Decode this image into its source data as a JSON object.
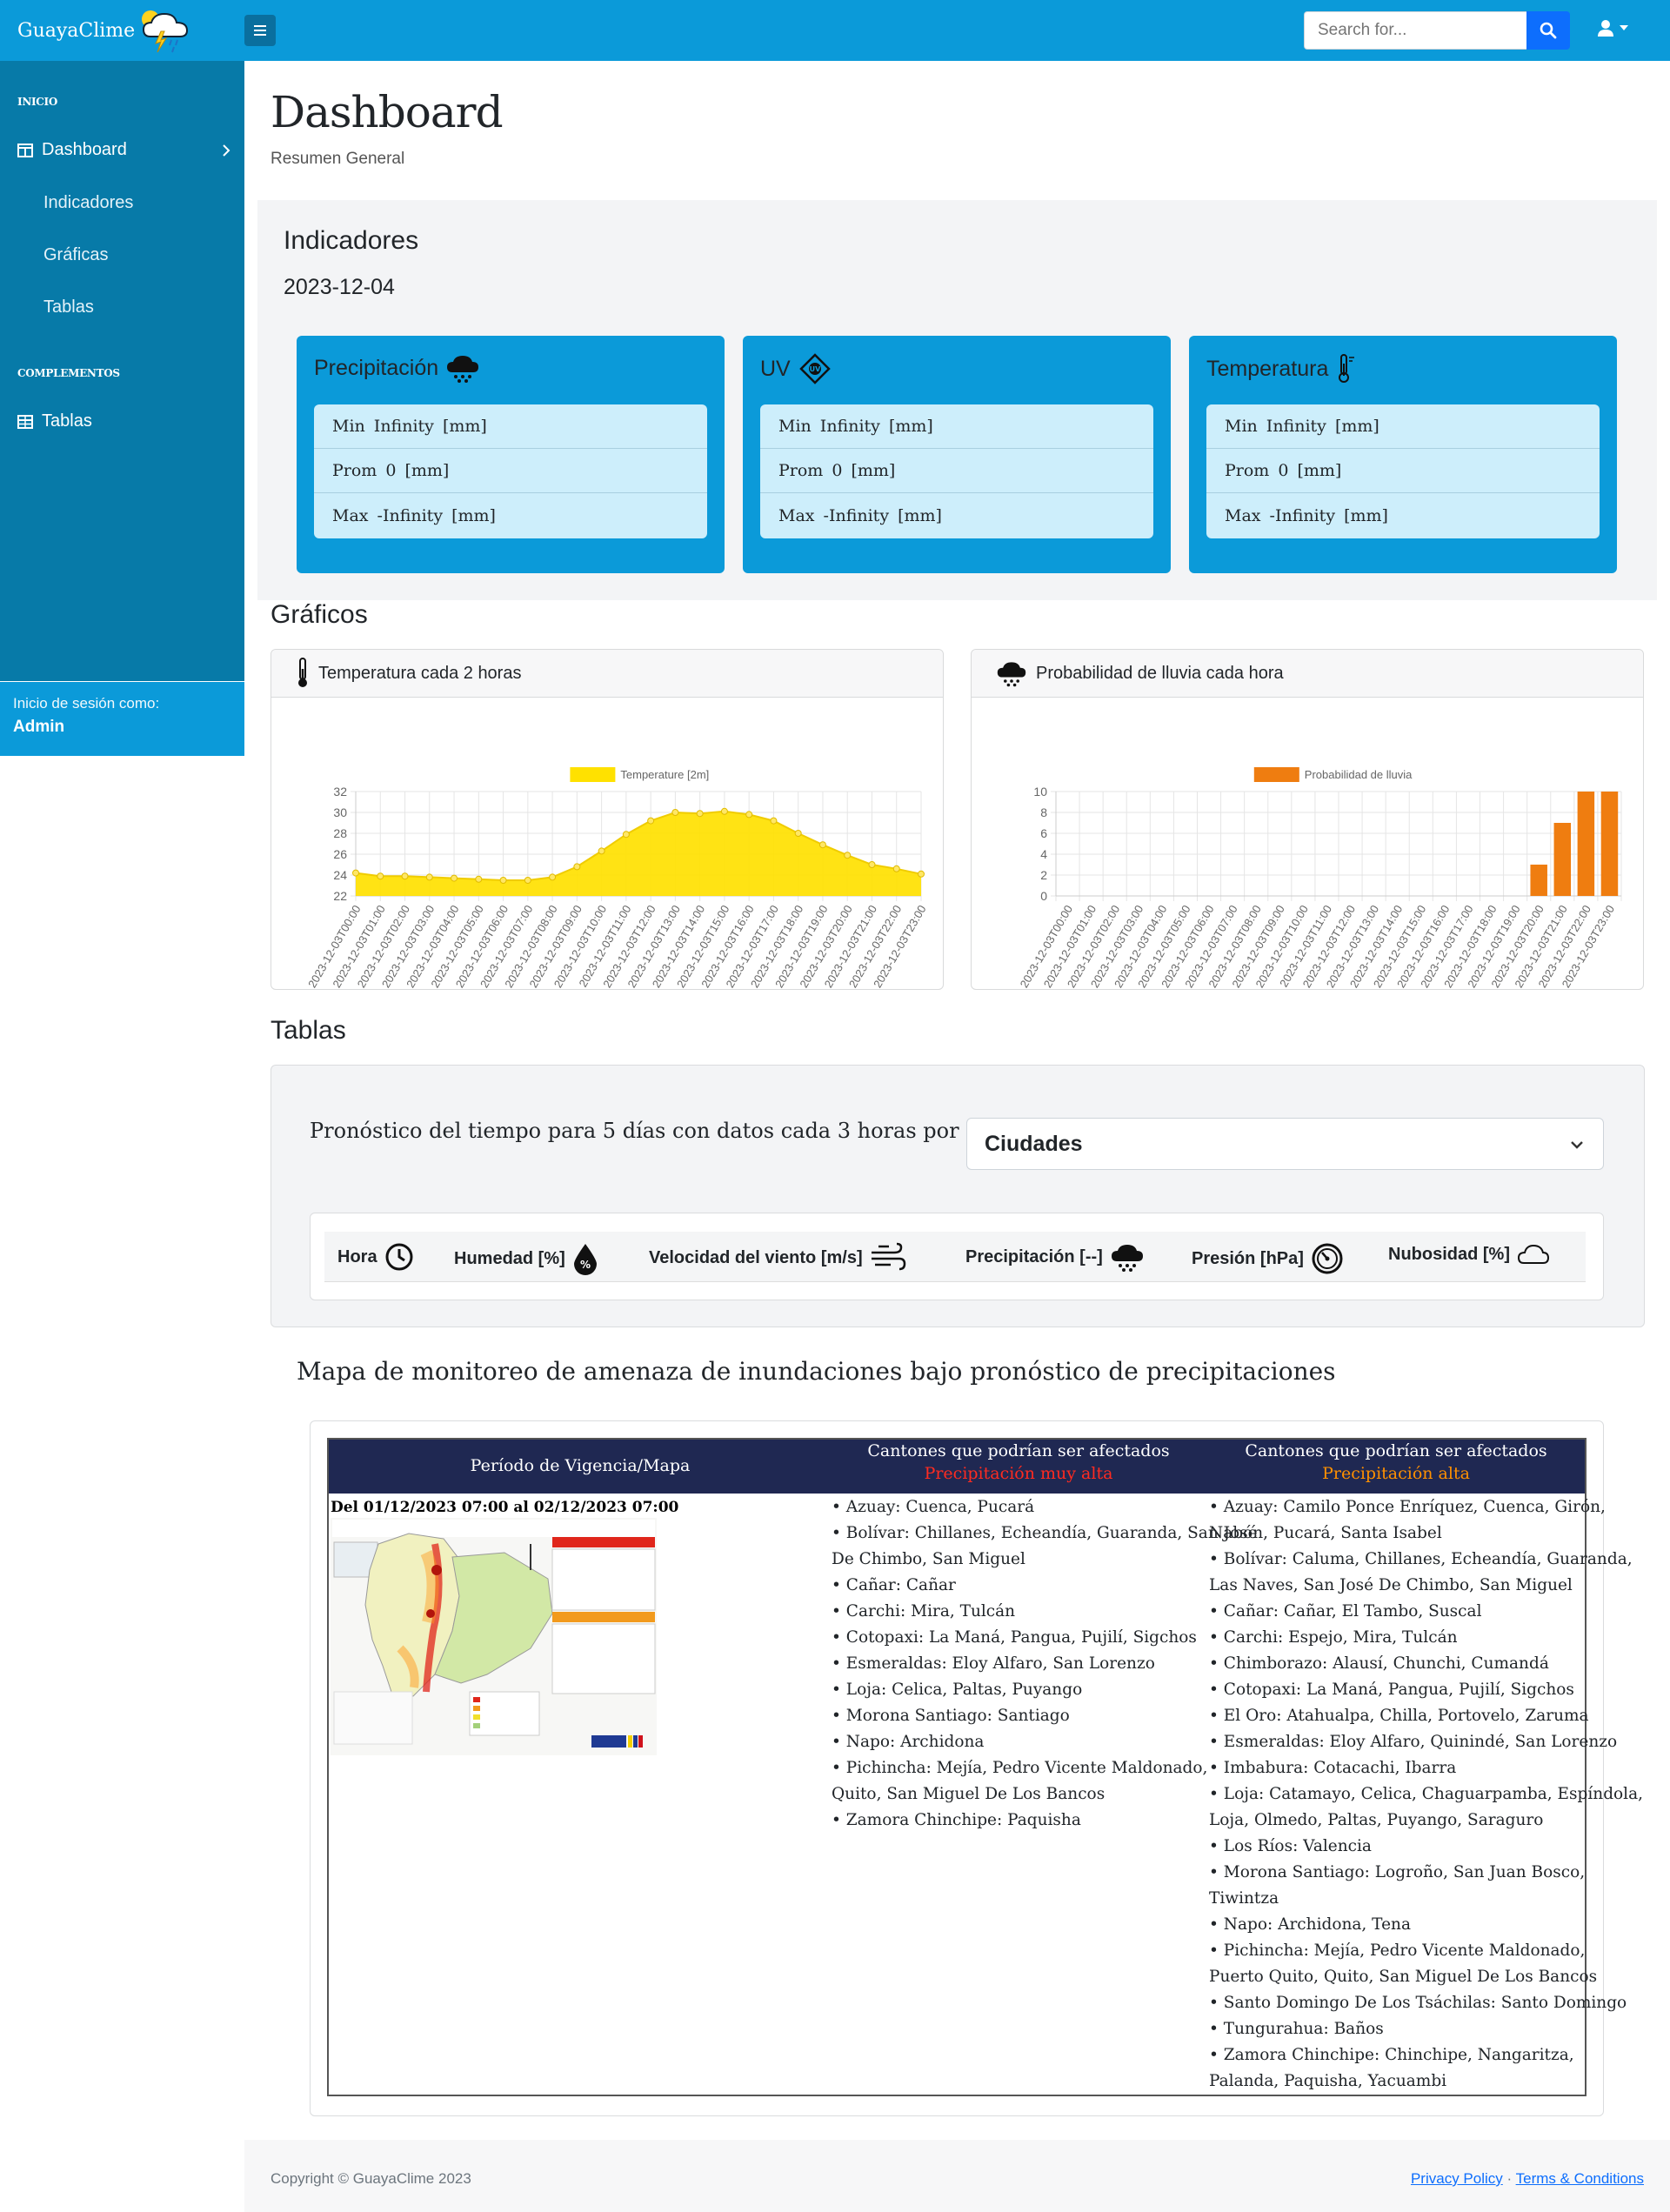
{
  "brand": {
    "name": "GuayaClime"
  },
  "search": {
    "placeholder": "Search for..."
  },
  "sidebar": {
    "heading_inicio": "INICIO",
    "dashboard_label": "Dashboard",
    "sub_items": [
      "Indicadores",
      "Gráficas",
      "Tablas"
    ],
    "heading_complementos": "COMPLEMENTOS",
    "tablas_label": "Tablas",
    "footer_small": "Inicio de sesión como:",
    "footer_user": "Admin"
  },
  "page": {
    "title": "Dashboard",
    "subtitle": "Resumen General"
  },
  "indicadores": {
    "title": "Indicadores",
    "date": "2023-12-04",
    "cards": [
      {
        "title": "Precipitación",
        "icon": "rain-cloud-icon",
        "rows": [
          "Min  Infinity  [mm]",
          "Prom  0  [mm]",
          "Max  -Infinity  [mm]"
        ]
      },
      {
        "title": "UV",
        "icon": "uv-sun-icon",
        "rows": [
          "Min  Infinity  [mm]",
          "Prom  0  [mm]",
          "Max  -Infinity  [mm]"
        ]
      },
      {
        "title": "Temperatura",
        "icon": "thermometer-icon",
        "rows": [
          "Min  Infinity  [mm]",
          "Prom  0  [mm]",
          "Max  -Infinity  [mm]"
        ]
      }
    ]
  },
  "graficos": {
    "title": "Gráficos",
    "temp_title": "Temperatura cada 2 horas",
    "rain_title": "Probabilidad de lluvia cada hora"
  },
  "chart_data": [
    {
      "type": "area",
      "title": "Temperatura cada 2 horas",
      "legend": "Temperature [2m]",
      "color": "#ffe100",
      "x": [
        "2023-12-03T00:00",
        "2023-12-03T01:00",
        "2023-12-03T02:00",
        "2023-12-03T03:00",
        "2023-12-03T04:00",
        "2023-12-03T05:00",
        "2023-12-03T06:00",
        "2023-12-03T07:00",
        "2023-12-03T08:00",
        "2023-12-03T09:00",
        "2023-12-03T10:00",
        "2023-12-03T11:00",
        "2023-12-03T12:00",
        "2023-12-03T13:00",
        "2023-12-03T14:00",
        "2023-12-03T15:00",
        "2023-12-03T16:00",
        "2023-12-03T17:00",
        "2023-12-03T18:00",
        "2023-12-03T19:00",
        "2023-12-03T20:00",
        "2023-12-03T21:00",
        "2023-12-03T22:00",
        "2023-12-03T23:00"
      ],
      "values": [
        24.2,
        23.9,
        23.9,
        23.8,
        23.7,
        23.6,
        23.5,
        23.5,
        23.8,
        24.8,
        26.3,
        27.9,
        29.2,
        30.0,
        29.9,
        30.1,
        29.8,
        29.2,
        28.0,
        26.9,
        25.9,
        25.0,
        24.6,
        24.1
      ],
      "yticks": [
        22,
        24,
        26,
        28,
        30,
        32
      ],
      "ylim": [
        22,
        32
      ]
    },
    {
      "type": "bar",
      "title": "Probabilidad de lluvia cada hora",
      "legend": "Probabilidad de lluvia",
      "color": "#ef7d10",
      "x": [
        "2023-12-03T00:00",
        "2023-12-03T01:00",
        "2023-12-03T02:00",
        "2023-12-03T03:00",
        "2023-12-03T04:00",
        "2023-12-03T05:00",
        "2023-12-03T06:00",
        "2023-12-03T07:00",
        "2023-12-03T08:00",
        "2023-12-03T09:00",
        "2023-12-03T10:00",
        "2023-12-03T11:00",
        "2023-12-03T12:00",
        "2023-12-03T13:00",
        "2023-12-03T14:00",
        "2023-12-03T15:00",
        "2023-12-03T16:00",
        "2023-12-03T17:00",
        "2023-12-03T18:00",
        "2023-12-03T19:00",
        "2023-12-03T20:00",
        "2023-12-03T21:00",
        "2023-12-03T22:00",
        "2023-12-03T23:00"
      ],
      "values": [
        0,
        0,
        0,
        0,
        0,
        0,
        0,
        0,
        0,
        0,
        0,
        0,
        0,
        0,
        0,
        0,
        0,
        0,
        0,
        0,
        3,
        7,
        10,
        10
      ],
      "yticks": [
        0,
        2,
        4,
        6,
        8,
        10
      ],
      "ylim": [
        0,
        10
      ]
    }
  ],
  "tablas": {
    "title": "Tablas",
    "description": "Pronóstico del tiempo para 5 días con datos cada 3 horas por ciudad",
    "select_value": "Ciudades",
    "headers": [
      "Hora",
      "Humedad [%]",
      "Velocidad del viento [m/s]",
      "Precipitación [--]",
      "Presión [hPa]",
      "Nubosidad [%]"
    ]
  },
  "mapa": {
    "title": "Mapa de monitoreo de amenaza de inundaciones bajo pronóstico de precipitaciones",
    "col1_header": "Período de Vigencia/Mapa",
    "col2_header": "Cantones que podrían ser afectados",
    "col2_sub": "Precipitación muy alta",
    "col3_header": "Cantones que podrían ser afectados",
    "col3_sub": "Precipitación alta",
    "period": "Del 01/12/2023 07:00 al 02/12/2023 07:00",
    "muy_alta": [
      "• Azuay: Cuenca, Pucará",
      "• Bolívar: Chillanes, Echeandía, Guaranda, San José",
      "De Chimbo, San Miguel",
      "• Cañar: Cañar",
      "• Carchi: Mira, Tulcán",
      "• Cotopaxi: La Maná, Pangua, Pujilí, Sigchos",
      "• Esmeraldas: Eloy Alfaro, San Lorenzo",
      "• Loja: Celica, Paltas, Puyango",
      "• Morona Santiago: Santiago",
      "• Napo: Archidona",
      "• Pichincha: Mejía, Pedro Vicente Maldonado,",
      "Quito, San Miguel De Los Bancos",
      "• Zamora Chinchipe: Paquisha"
    ],
    "alta": [
      "• Azuay: Camilo Ponce Enríquez, Cuenca, Girón,",
      "Nabón, Pucará, Santa Isabel",
      "• Bolívar: Caluma, Chillanes, Echeandía, Guaranda,",
      "Las Naves, San José De Chimbo, San Miguel",
      "• Cañar: Cañar, El Tambo, Suscal",
      "• Carchi: Espejo, Mira, Tulcán",
      "• Chimborazo: Alausí, Chunchi, Cumandá",
      "• Cotopaxi: La Maná, Pangua, Pujilí, Sigchos",
      "• El Oro: Atahualpa, Chilla, Portovelo, Zaruma",
      "• Esmeraldas: Eloy Alfaro, Quinindé, San Lorenzo",
      "• Imbabura: Cotacachi, Ibarra",
      "• Loja: Catamayo, Celica, Chaguarpamba, Espíndola,",
      "Loja, Olmedo, Paltas, Puyango, Saraguro",
      "• Los Ríos: Valencia",
      "• Morona Santiago: Logroño, San Juan Bosco,",
      "Tiwintza",
      "• Napo: Archidona, Tena",
      "• Pichincha: Mejía, Pedro Vicente Maldonado,",
      "Puerto Quito, Quito, San Miguel De Los Bancos",
      "• Santo Domingo De Los Tsáchilas: Santo Domingo",
      "• Tungurahua: Baños",
      "• Zamora Chinchipe: Chinchipe, Nangaritza,",
      "Palanda, Paquisha, Yacuambi"
    ]
  },
  "footer": {
    "copyright": "Copyright © GuayaClime 2023",
    "privacy": "Privacy Policy",
    "sep": "·",
    "terms": "Terms & Conditions"
  }
}
